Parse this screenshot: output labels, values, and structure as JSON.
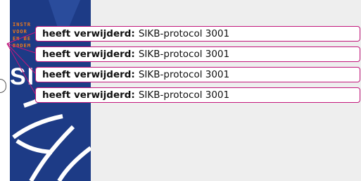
{
  "tooltips": [
    {
      "label": "heeft verwijderd:",
      "value": "SIKB-protocol 3001"
    },
    {
      "label": "heeft verwijderd:",
      "value": "SIKB-protocol 3001"
    },
    {
      "label": "heeft verwijderd:",
      "value": "SIKB-protocol 3001"
    },
    {
      "label": "heeft verwijderd:",
      "value": "SIKB-protocol 3001"
    }
  ],
  "logo": {
    "tagline": "INSTR\nVOOR\nEN BE\nBODEM",
    "letters": "SI"
  },
  "colors": {
    "tooltip_border": "#c2187c",
    "logo_background": "#1d3b86",
    "logo_accent": "#f07a1a"
  }
}
